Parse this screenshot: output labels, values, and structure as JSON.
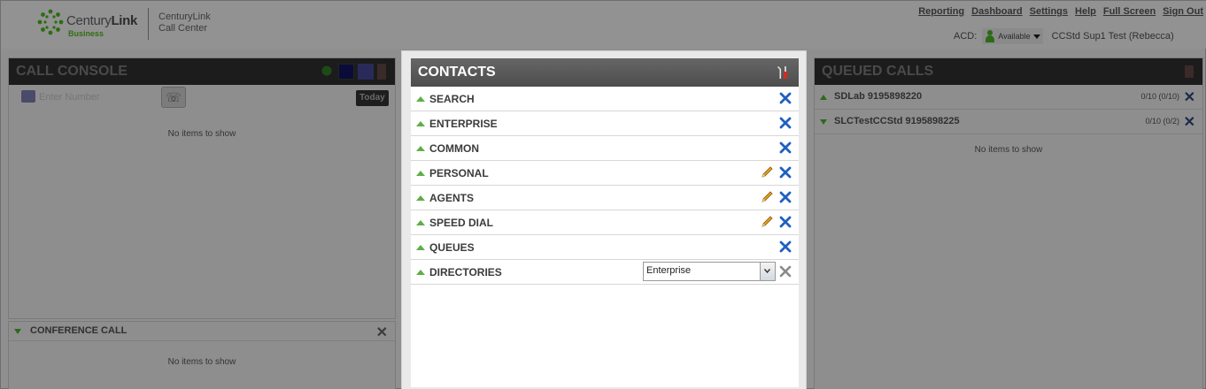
{
  "header": {
    "logo_brand_main": "Century",
    "logo_brand_bold": "Link",
    "logo_sub": "Business",
    "logo_product_line1": "CenturyLink",
    "logo_product_line2": "Call Center",
    "links": [
      "Reporting",
      "Dashboard",
      "Settings",
      "Help",
      "Full Screen",
      "Sign Out"
    ],
    "acd_label": "ACD:",
    "acd_status": "Available",
    "user_name": "CCStd Sup1 Test (Rebecca)"
  },
  "call_console": {
    "title": "CALL CONSOLE",
    "dial_placeholder": "Enter Number",
    "today_label": "Today",
    "empty_text": "No items to show"
  },
  "conference": {
    "title": "CONFERENCE CALL",
    "empty_text": "No items to show"
  },
  "contacts": {
    "title": "CONTACTS",
    "rows": [
      {
        "label": "SEARCH",
        "editable": false
      },
      {
        "label": "ENTERPRISE",
        "editable": false
      },
      {
        "label": "COMMON",
        "editable": false
      },
      {
        "label": "PERSONAL",
        "editable": true
      },
      {
        "label": "AGENTS",
        "editable": true
      },
      {
        "label": "SPEED DIAL",
        "editable": true
      },
      {
        "label": "QUEUES",
        "editable": false
      }
    ],
    "directories": {
      "label": "DIRECTORIES",
      "selected": "Enterprise"
    }
  },
  "queued_calls": {
    "title": "QUEUED CALLS",
    "queues": [
      {
        "name": "SDLab 9195898220",
        "count": "0/10 (0/10)"
      },
      {
        "name": "SLCTestCCStd 9195898225",
        "count": "0/10 (0/2)"
      }
    ],
    "empty_text": "No items to show"
  },
  "colors": {
    "contacts_header": "#555555",
    "accent_green": "#5fae45",
    "close_blue": "#1f5fbf",
    "pencil_orange": "#e0a020"
  }
}
